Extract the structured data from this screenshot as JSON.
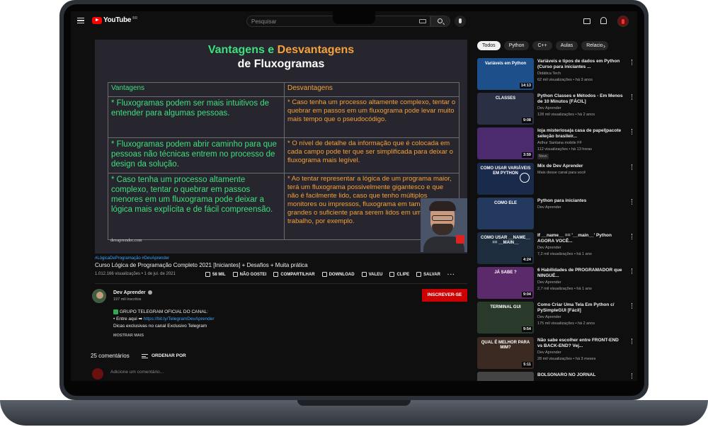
{
  "topbar": {
    "brand": "YouTube",
    "country": "BR",
    "search_placeholder": "Pesquisar"
  },
  "slide": {
    "title_part1": "Vantagens e ",
    "title_part2": "Desvantagens",
    "subtitle": "de Fluxogramas",
    "col_left": "Vantagens",
    "col_right": "Desvantagens",
    "rows": [
      {
        "left": "* Fluxogramas podem ser mais intuitivos de entender para algumas pessoas.",
        "right": "* Caso tenha um processo altamente complexo, tentar o quebrar em passos em um fluxograma pode levar muito mais tempo que o pseudocódigo."
      },
      {
        "left": "* Fluxogramas podem abrir caminho para que pessoas não técnicas entrem no processo de design da solução.",
        "right": "* O nível de detalhe da informação que é colocada em cada campo pode ter que ser simplificada para deixar o fluxograma mais legível."
      },
      {
        "left": "* Caso tenha um processo altamente complexo, tentar o quebrar em passos menores em um fluxograma pode deixar a lógica mais explícita e de fácil compreensão.",
        "right": "* Ao tentar representar a lógica de um programa maior, terá um fluxograma possivelmente gigantesco e que não é facilmente lido, caso que tenho múltiplos monitores ou impressos, fluxograma em tamanhos grandes o suficiente para serem lidos em uma mesa no trabalho, por exemplo."
      }
    ],
    "url": "devaprender.com"
  },
  "video": {
    "hashtags": "#LógicaDeProgramação #DevAprender",
    "title": "Curso Lógica de Programação Completo 2021 [Iniciantes] + Desafios + Muita prática",
    "views": "1.012.166 visualizações • 1 de jul. de 2021",
    "actions": {
      "like": "58 MIL",
      "dislike": "NÃO GOSTEI",
      "share": "COMPARTILHAR",
      "download": "DOWNLOAD",
      "thanks": "VALEU",
      "clip": "CLIPE",
      "save": "SALVAR"
    }
  },
  "channel": {
    "name": "Dev Aprender",
    "subs": "197 mil inscritos",
    "subscribe": "INSCREVER-SE"
  },
  "description": {
    "line1": "GRUPO TELEGRAM OFICIAL DO CANAL:",
    "line2_prefix": "• Entre aqui ➡ ",
    "line2_link": "https://bit.ly/TelegramDevAprender",
    "line3": "Dicas exclusivas no canal Exclusivo Telegram",
    "show_more": "MOSTRAR MAIS"
  },
  "comments": {
    "count": "25 comentários",
    "sort": "ORDENAR POR",
    "placeholder": "Adicione um comentário..."
  },
  "chips": [
    "Todos",
    "Python",
    "C++",
    "Aulas",
    "Relacio"
  ],
  "recommendations": [
    {
      "title": "Variáveis e tipos de dados em Python (Curso para iniciantes ...",
      "channel": "Didática Tech",
      "meta": "62 mil visualizações • há 3 anos",
      "duration": "14:13",
      "thumb_text": "Variáveis em Python",
      "color": "#1d4f8a"
    },
    {
      "title": "Python Classes e Métodos - Em Menos de 10 Minutos [FÁCIL]",
      "channel": "Dev Aprender",
      "meta": "128 mil visualizações • há 2 anos",
      "duration": "9:08",
      "thumb_text": "CLASSES",
      "color": "#2a2f44"
    },
    {
      "title": "loja misteriosa|a casa de papel|pacote seleção brasileir...",
      "channel": "Arthur Santana mobile FF",
      "meta": "112 visualizações • há 13 horas",
      "duration": "3:59",
      "thumb_text": "",
      "color": "#4b2a6e",
      "badge": "Novo"
    },
    {
      "title": "Mix de Dev Aprender",
      "channel": "Mais desse canal para você",
      "meta": "",
      "duration": "",
      "thumb_text": "COMO USAR VARIÁVEIS EM PYTHON",
      "color": "#1a2a4a"
    },
    {
      "title": "Python para iniciantes",
      "channel": "Dev Aprender",
      "meta": "",
      "duration": "",
      "thumb_text": "COMO ELE",
      "color": "#233a5e"
    },
    {
      "title": "If __name__ == '__main__' Python AGORA VOCÊ...",
      "channel": "Dev Aprender",
      "meta": "7,2 mil visualizações • há 1 ano",
      "duration": "4:24",
      "thumb_text": "COMO USAR __NAME__ == __MAIN__",
      "color": "#1d2d3d"
    },
    {
      "title": "6 Habilidades de PROGRAMADOR que NINGUÉ...",
      "channel": "Dev Aprender",
      "meta": "2,7 mil visualizações • há 1 ano",
      "duration": "9:04",
      "thumb_text": "JÁ SABE ?",
      "color": "#5a2a6a"
    },
    {
      "title": "Como Criar Uma Tela Em Python c/ PySimpleGUI [Fácil]",
      "channel": "Dev Aprender",
      "meta": "175 mil visualizações • há 2 anos",
      "duration": "9:54",
      "thumb_text": "TERMINAL GUI",
      "color": "#2a3a2a"
    },
    {
      "title": "Não sabe escolher entre FRONT-END vs BACK-END? Vej...",
      "channel": "Dev Aprender",
      "meta": "28 mil visualizações • há 3 meses",
      "duration": "5:11",
      "thumb_text": "QUAL É MELHOR PARA MIM?",
      "color": "#3a2a22"
    },
    {
      "title": "BOLSONARO NO JORNAL",
      "channel": "",
      "meta": "",
      "duration": "",
      "thumb_text": "",
      "color": "#444444"
    }
  ],
  "colors": {
    "accent_green": "#3de07d",
    "accent_orange": "#f6a23a",
    "subscribe_red": "#cc0000",
    "link_blue": "#3ea6ff"
  }
}
